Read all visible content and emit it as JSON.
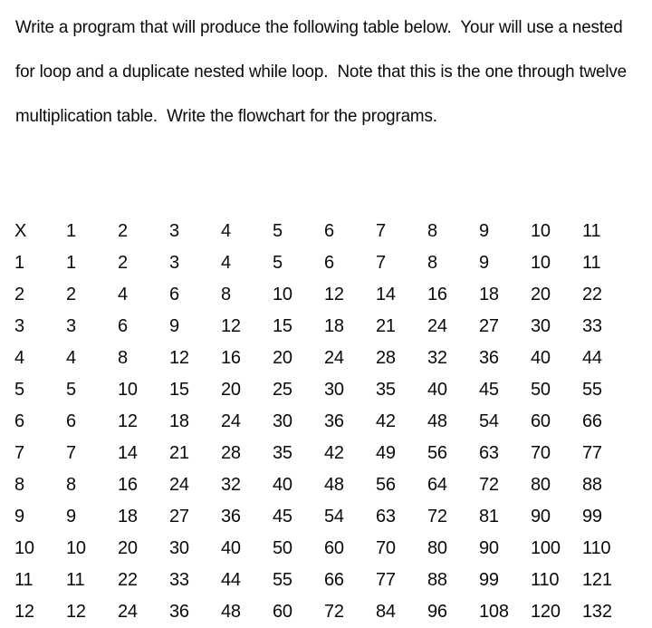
{
  "document": {
    "background_color": "#ffffff",
    "text_color": "#0a0a0a",
    "paragraphs": [
      "Write a program that will produce the following table below.  Your will use a nested",
      "for loop and a duplicate nested while loop.  Note that this is the one through twelve",
      "multiplication table.  Write the flowchart for the programs."
    ]
  },
  "table": {
    "corner_label": "X",
    "column_headers": [
      "1",
      "2",
      "3",
      "4",
      "5",
      "6",
      "7",
      "8",
      "9",
      "10",
      "11"
    ],
    "rows": [
      {
        "header": "1",
        "cells": [
          "1",
          "2",
          "3",
          "4",
          "5",
          "6",
          "7",
          "8",
          "9",
          "10",
          "11"
        ]
      },
      {
        "header": "2",
        "cells": [
          "2",
          "4",
          "6",
          "8",
          "10",
          "12",
          "14",
          "16",
          "18",
          "20",
          "22"
        ]
      },
      {
        "header": "3",
        "cells": [
          "3",
          "6",
          "9",
          "12",
          "15",
          "18",
          "21",
          "24",
          "27",
          "30",
          "33"
        ]
      },
      {
        "header": "4",
        "cells": [
          "4",
          "8",
          "12",
          "16",
          "20",
          "24",
          "28",
          "32",
          "36",
          "40",
          "44"
        ]
      },
      {
        "header": "5",
        "cells": [
          "5",
          "10",
          "15",
          "20",
          "25",
          "30",
          "35",
          "40",
          "45",
          "50",
          "55"
        ]
      },
      {
        "header": "6",
        "cells": [
          "6",
          "12",
          "18",
          "24",
          "30",
          "36",
          "42",
          "48",
          "54",
          "60",
          "66"
        ]
      },
      {
        "header": "7",
        "cells": [
          "7",
          "14",
          "21",
          "28",
          "35",
          "42",
          "49",
          "56",
          "63",
          "70",
          "77"
        ]
      },
      {
        "header": "8",
        "cells": [
          "8",
          "16",
          "24",
          "32",
          "40",
          "48",
          "56",
          "64",
          "72",
          "80",
          "88"
        ]
      },
      {
        "header": "9",
        "cells": [
          "9",
          "18",
          "27",
          "36",
          "45",
          "54",
          "63",
          "72",
          "81",
          "90",
          "99"
        ]
      },
      {
        "header": "10",
        "cells": [
          "10",
          "20",
          "30",
          "40",
          "50",
          "60",
          "70",
          "80",
          "90",
          "100",
          "110"
        ]
      },
      {
        "header": "11",
        "cells": [
          "11",
          "22",
          "33",
          "44",
          "55",
          "66",
          "77",
          "88",
          "99",
          "110",
          "121"
        ]
      },
      {
        "header": "12",
        "cells": [
          "12",
          "24",
          "36",
          "48",
          "60",
          "72",
          "84",
          "96",
          "108",
          "120",
          "132"
        ]
      }
    ]
  }
}
